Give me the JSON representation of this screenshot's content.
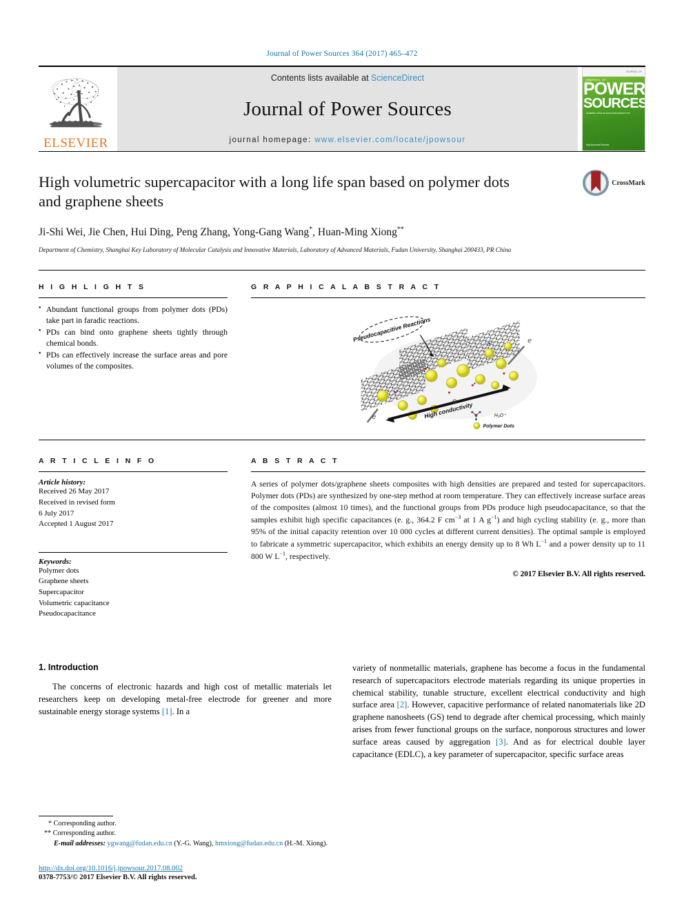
{
  "running_head": "Journal of Power Sources 364 (2017) 465–472",
  "masthead": {
    "publisher_name": "ELSEVIER",
    "contents_prefix": "Contents lists available at ",
    "contents_link": "ScienceDirect",
    "journal_title": "Journal of Power Sources",
    "homepage_label": "journal homepage: ",
    "homepage_url": "www.elsevier.com/locate/jpowsour",
    "cover": {
      "top_strip": "JOURNAL OF",
      "kicker": "JOURNAL OF",
      "line1": "POWER",
      "line2": "SOURCES",
      "sub": "Available online at\nwww.sciencedirect.com",
      "foot": "http://journals\nElsevier"
    }
  },
  "article": {
    "title": "High volumetric supercapacitor with a long life span based on polymer dots and graphene sheets",
    "authors_html": "Ji-Shi Wei, Jie Chen, Hui Ding, Peng Zhang, Yong-Gang Wang<sup>*</sup>, Huan-Ming Xiong<sup>**</sup>",
    "affiliation": "Department of Chemistry, Shanghai Key Laboratory of Molecular Catalysis and Innovative Materials, Laboratory of Advanced Materials, Fudan University, Shanghai 200433, PR China",
    "crossmark_label": "CrossMark"
  },
  "highlights": {
    "heading": "H I G H L I G H T S",
    "items": [
      "Abundant functional groups from polymer dots (PDs) take part in faradic reactions.",
      "PDs can bind onto graphene sheets tightly through chemical bonds.",
      "PDs can effectively increase the surface areas and pore volumes of the composites."
    ]
  },
  "graphical_abstract": {
    "heading": "G R A P H I C A L   A B S T R A C T",
    "labels": {
      "pseudo": "Pseudocapacitive Reactions",
      "conductivity": "High conductivity",
      "electron": "e",
      "hydronium": "H₃O⁺",
      "polymer_dots": "Polymer Dots"
    }
  },
  "article_info": {
    "heading": "A R T I C L E   I N F O",
    "history_label": "Article history:",
    "history": [
      "Received 26 May 2017",
      "Received in revised form",
      "6 July 2017",
      "Accepted 1 August 2017"
    ],
    "keywords_label": "Keywords:",
    "keywords": [
      "Polymer dots",
      "Graphene sheets",
      "Supercapacitor",
      "Volumetric capacitance",
      "Pseudocapacitance"
    ]
  },
  "abstract": {
    "heading": "A B S T R A C T",
    "text_html": "A series of polymer dots/graphene sheets composites with high densities are prepared and tested for supercapacitors. Polymer dots (PDs) are synthesized by one-step method at room temperature. They can effectively increase surface areas of the composites (almost 10 times), and the functional groups from PDs produce high pseudocapacitance, so that the samples exhibit high specific capacitances (e. g., 364.2 F cm<sup>−3</sup> at 1 A g<sup>−1</sup>) and high cycling stability (e. g., more than 95% of the initial capacity retention over 10 000 cycles at different current densities). The optimal sample is employed to fabricate a symmetric supercapacitor, which exhibits an energy density up to 8 Wh L<sup>−1</sup> and a power density up to 11 800 W L<sup>−1</sup>, respectively.",
    "copyright": "© 2017 Elsevier B.V. All rights reserved."
  },
  "body": {
    "section_heading": "1.  Introduction",
    "left_paragraph_html": "The concerns of electronic hazards and high cost of metallic materials let researchers keep on developing metal-free electrode for greener and more sustainable energy storage systems <a class=\"ref\" href=\"#\">[1]</a>. In a",
    "right_paragraph_html": "variety of nonmetallic materials, graphene has become a focus in the fundamental research of supercapacitors electrode materials regarding its unique properties in chemical stability, tunable structure, excellent electrical conductivity and high surface area <a class=\"ref\" href=\"#\">[2]</a>. However, capacitive performance of related nanomaterials like 2D graphene nanosheets (GS) tend to degrade after chemical processing, which mainly arises from fewer functional groups on the surface, nonporous structures and lower surface areas caused by aggregation <a class=\"ref\" href=\"#\">[3]</a>. And as for electrical double layer capacitance (EDLC), a key parameter of supercapacitor, specific surface areas"
  },
  "footnotes": {
    "line1": "* Corresponding author.",
    "line2": "** Corresponding author.",
    "email_label": "E-mail addresses:",
    "email1": "ygwang@fudan.edu.cn",
    "email1_owner": "(Y.-G. Wang),",
    "email2": "hmxiong@fudan.edu.cn",
    "email2_owner": "(H.-M. Xiong)."
  },
  "footer": {
    "doi": "http://dx.doi.org/10.1016/j.jpowsour.2017.08.002",
    "issn": "0378-7753/© 2017 Elsevier B.V. All rights reserved."
  },
  "colors": {
    "link_blue": "#1673a8",
    "elsevier_orange": "#E87722",
    "banner_gray": "#e3e3e3",
    "cover_green": "#5fae2e",
    "crossmark_red": "#a31f21"
  }
}
